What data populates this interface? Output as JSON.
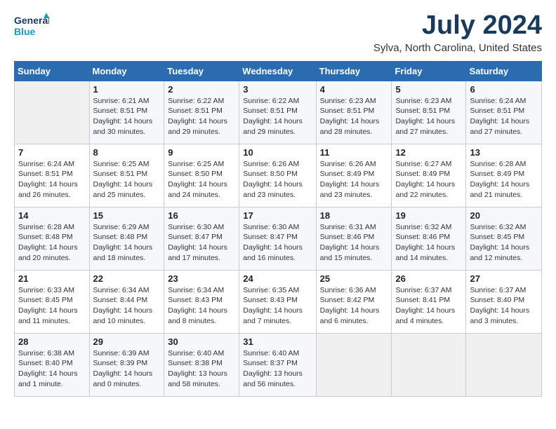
{
  "logo": {
    "line1": "General",
    "line2": "Blue"
  },
  "title": "July 2024",
  "subtitle": "Sylva, North Carolina, United States",
  "calendar": {
    "headers": [
      "Sunday",
      "Monday",
      "Tuesday",
      "Wednesday",
      "Thursday",
      "Friday",
      "Saturday"
    ],
    "weeks": [
      [
        {
          "day": "",
          "info": ""
        },
        {
          "day": "1",
          "info": "Sunrise: 6:21 AM\nSunset: 8:51 PM\nDaylight: 14 hours\nand 30 minutes."
        },
        {
          "day": "2",
          "info": "Sunrise: 6:22 AM\nSunset: 8:51 PM\nDaylight: 14 hours\nand 29 minutes."
        },
        {
          "day": "3",
          "info": "Sunrise: 6:22 AM\nSunset: 8:51 PM\nDaylight: 14 hours\nand 29 minutes."
        },
        {
          "day": "4",
          "info": "Sunrise: 6:23 AM\nSunset: 8:51 PM\nDaylight: 14 hours\nand 28 minutes."
        },
        {
          "day": "5",
          "info": "Sunrise: 6:23 AM\nSunset: 8:51 PM\nDaylight: 14 hours\nand 27 minutes."
        },
        {
          "day": "6",
          "info": "Sunrise: 6:24 AM\nSunset: 8:51 PM\nDaylight: 14 hours\nand 27 minutes."
        }
      ],
      [
        {
          "day": "7",
          "info": "Sunrise: 6:24 AM\nSunset: 8:51 PM\nDaylight: 14 hours\nand 26 minutes."
        },
        {
          "day": "8",
          "info": "Sunrise: 6:25 AM\nSunset: 8:51 PM\nDaylight: 14 hours\nand 25 minutes."
        },
        {
          "day": "9",
          "info": "Sunrise: 6:25 AM\nSunset: 8:50 PM\nDaylight: 14 hours\nand 24 minutes."
        },
        {
          "day": "10",
          "info": "Sunrise: 6:26 AM\nSunset: 8:50 PM\nDaylight: 14 hours\nand 23 minutes."
        },
        {
          "day": "11",
          "info": "Sunrise: 6:26 AM\nSunset: 8:49 PM\nDaylight: 14 hours\nand 23 minutes."
        },
        {
          "day": "12",
          "info": "Sunrise: 6:27 AM\nSunset: 8:49 PM\nDaylight: 14 hours\nand 22 minutes."
        },
        {
          "day": "13",
          "info": "Sunrise: 6:28 AM\nSunset: 8:49 PM\nDaylight: 14 hours\nand 21 minutes."
        }
      ],
      [
        {
          "day": "14",
          "info": "Sunrise: 6:28 AM\nSunset: 8:48 PM\nDaylight: 14 hours\nand 20 minutes."
        },
        {
          "day": "15",
          "info": "Sunrise: 6:29 AM\nSunset: 8:48 PM\nDaylight: 14 hours\nand 18 minutes."
        },
        {
          "day": "16",
          "info": "Sunrise: 6:30 AM\nSunset: 8:47 PM\nDaylight: 14 hours\nand 17 minutes."
        },
        {
          "day": "17",
          "info": "Sunrise: 6:30 AM\nSunset: 8:47 PM\nDaylight: 14 hours\nand 16 minutes."
        },
        {
          "day": "18",
          "info": "Sunrise: 6:31 AM\nSunset: 8:46 PM\nDaylight: 14 hours\nand 15 minutes."
        },
        {
          "day": "19",
          "info": "Sunrise: 6:32 AM\nSunset: 8:46 PM\nDaylight: 14 hours\nand 14 minutes."
        },
        {
          "day": "20",
          "info": "Sunrise: 6:32 AM\nSunset: 8:45 PM\nDaylight: 14 hours\nand 12 minutes."
        }
      ],
      [
        {
          "day": "21",
          "info": "Sunrise: 6:33 AM\nSunset: 8:45 PM\nDaylight: 14 hours\nand 11 minutes."
        },
        {
          "day": "22",
          "info": "Sunrise: 6:34 AM\nSunset: 8:44 PM\nDaylight: 14 hours\nand 10 minutes."
        },
        {
          "day": "23",
          "info": "Sunrise: 6:34 AM\nSunset: 8:43 PM\nDaylight: 14 hours\nand 8 minutes."
        },
        {
          "day": "24",
          "info": "Sunrise: 6:35 AM\nSunset: 8:43 PM\nDaylight: 14 hours\nand 7 minutes."
        },
        {
          "day": "25",
          "info": "Sunrise: 6:36 AM\nSunset: 8:42 PM\nDaylight: 14 hours\nand 6 minutes."
        },
        {
          "day": "26",
          "info": "Sunrise: 6:37 AM\nSunset: 8:41 PM\nDaylight: 14 hours\nand 4 minutes."
        },
        {
          "day": "27",
          "info": "Sunrise: 6:37 AM\nSunset: 8:40 PM\nDaylight: 14 hours\nand 3 minutes."
        }
      ],
      [
        {
          "day": "28",
          "info": "Sunrise: 6:38 AM\nSunset: 8:40 PM\nDaylight: 14 hours\nand 1 minute."
        },
        {
          "day": "29",
          "info": "Sunrise: 6:39 AM\nSunset: 8:39 PM\nDaylight: 14 hours\nand 0 minutes."
        },
        {
          "day": "30",
          "info": "Sunrise: 6:40 AM\nSunset: 8:38 PM\nDaylight: 13 hours\nand 58 minutes."
        },
        {
          "day": "31",
          "info": "Sunrise: 6:40 AM\nSunset: 8:37 PM\nDaylight: 13 hours\nand 56 minutes."
        },
        {
          "day": "",
          "info": ""
        },
        {
          "day": "",
          "info": ""
        },
        {
          "day": "",
          "info": ""
        }
      ]
    ]
  }
}
